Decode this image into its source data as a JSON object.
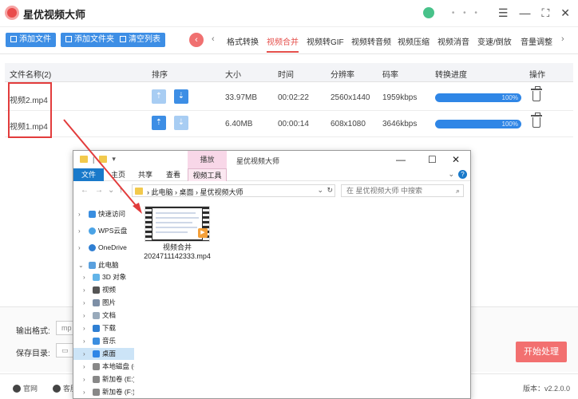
{
  "app": {
    "title": "星优视频大师"
  },
  "toolbar": {
    "add_file": "添加文件",
    "add_folder": "添加文件夹",
    "clear_list": "清空列表",
    "features": [
      "格式转换",
      "视频合并",
      "视频转GIF",
      "视频转音频",
      "视频压缩",
      "视频消音",
      "变速/倒放",
      "音量调整"
    ],
    "active_feature": "视频合并"
  },
  "table": {
    "headers": [
      "文件名称(2)",
      "排序",
      "大小",
      "时间",
      "分辨率",
      "码率",
      "转换进度",
      "操作"
    ],
    "rows": [
      {
        "name": "视频2.mp4",
        "size": "33.97MB",
        "duration": "00:02:22",
        "resolution": "2560x1440",
        "bitrate": "1959kbps",
        "progress": 1.0,
        "progress_label": "100%"
      },
      {
        "name": "视频1.mp4",
        "size": "6.40MB",
        "duration": "00:00:14",
        "resolution": "608x1080",
        "bitrate": "3646kbps",
        "progress": 1.0,
        "progress_label": "100%"
      }
    ]
  },
  "bottom": {
    "output_format_label": "输出格式:",
    "output_format_value": "mp",
    "save_dir_label": "保存目录:",
    "start_button": "开始处理"
  },
  "statusbar": {
    "site": "官网",
    "support": "客服",
    "version": "版本：v2.2.0.0"
  },
  "explorer": {
    "title": "星优视频大师",
    "play_tab": "播放",
    "ribbon_tabs": [
      "文件",
      "主页",
      "共享",
      "查看",
      "视频工具"
    ],
    "breadcrumb": [
      "此电脑",
      "桌面",
      "星优视频大师"
    ],
    "search_placeholder": "在 星优视频大师 中搜索",
    "nav_items": [
      "快速访问",
      "WPS云盘",
      "OneDrive",
      "此电脑",
      "3D 对象",
      "视频",
      "图片",
      "文档",
      "下载",
      "音乐",
      "桌面",
      "本地磁盘 (C",
      "新加卷 (E:)",
      "新加卷 (F:)"
    ],
    "selected_nav": "桌面",
    "file": {
      "name_line1": "视频合并",
      "name_line2": "2024711142333.mp4"
    }
  },
  "colors": {
    "accent_blue": "#3d8ee5",
    "accent_red": "#e5504c",
    "progress": "#2f86e6"
  }
}
